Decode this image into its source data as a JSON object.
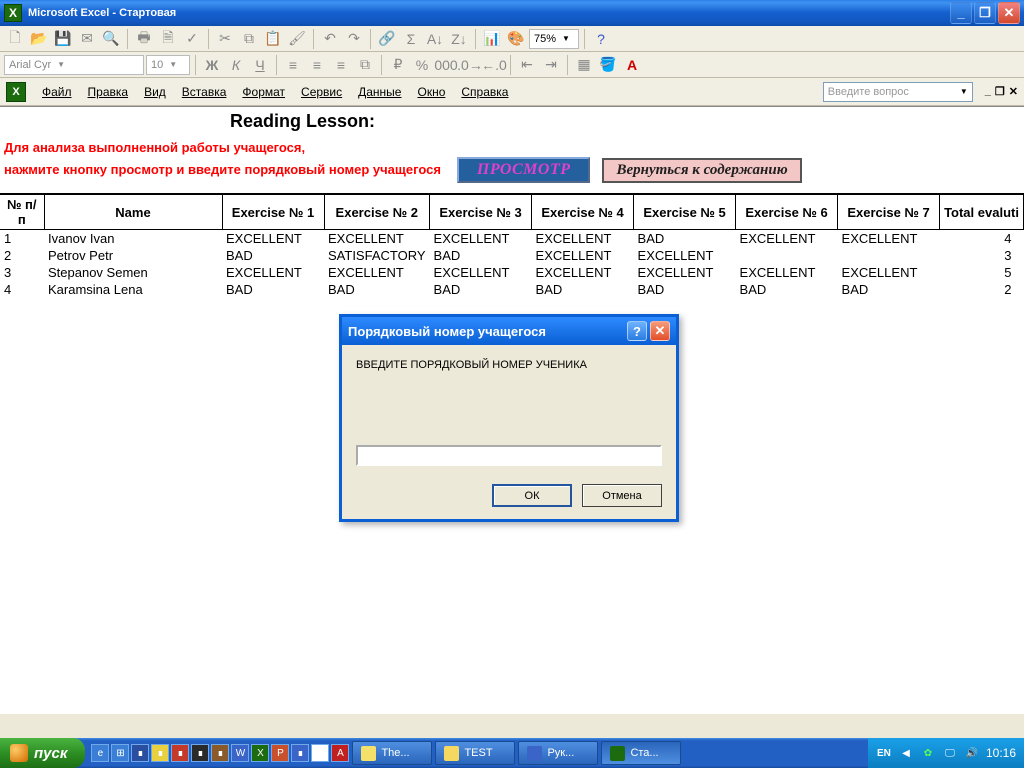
{
  "window": {
    "title": "Microsoft Excel - Стартовая"
  },
  "toolbar": {
    "font": "Arial Cyr",
    "size": "10",
    "zoom": "75%"
  },
  "menu": {
    "file": "Файл",
    "edit": "Правка",
    "view": "Вид",
    "insert": "Вставка",
    "format": "Формат",
    "tools": "Сервис",
    "data": "Данные",
    "window": "Окно",
    "help": "Справка"
  },
  "questionbox_placeholder": "Введите вопрос",
  "sheet": {
    "title": "Reading Lesson:",
    "instr1": "Для анализа  выполненной работы учащегося,",
    "instr2": "нажмите кнопку просмотр и введите порядковый номер учащегося",
    "btn_view": "ПРОСМОТР",
    "btn_return": "Вернуться к содержанию",
    "headers": [
      "№ п/п",
      "Name",
      "Exercise № 1",
      "Exercise № 2",
      "Exercise № 3",
      "Exercise № 4",
      "Exercise № 5",
      "Exercise № 6",
      "Exercise № 7",
      "Total evaluti"
    ],
    "rows": [
      {
        "n": "1",
        "name": "Ivanov Ivan",
        "e": [
          "EXCELLENT",
          "EXCELLENT",
          "EXCELLENT",
          "EXCELLENT",
          "BAD",
          "EXCELLENT",
          "EXCELLENT"
        ],
        "total": "4"
      },
      {
        "n": "2",
        "name": "Petrov Petr",
        "e": [
          "BAD",
          "SATISFACTORY",
          "BAD",
          "EXCELLENT",
          "EXCELLENT",
          "",
          ""
        ],
        "total": "3"
      },
      {
        "n": "3",
        "name": "Stepanov Semen",
        "e": [
          "EXCELLENT",
          "EXCELLENT",
          "EXCELLENT",
          "EXCELLENT",
          "EXCELLENT",
          "EXCELLENT",
          "EXCELLENT"
        ],
        "total": "5"
      },
      {
        "n": "4",
        "name": "Karamsina Lena",
        "e": [
          "BAD",
          "BAD",
          "BAD",
          "BAD",
          "BAD",
          "BAD",
          "BAD"
        ],
        "total": "2"
      }
    ]
  },
  "dialog": {
    "title": "Порядковый номер учащегося",
    "label": "ВВЕДИТЕ ПОРЯДКОВЫЙ НОМЕР УЧЕНИКА",
    "ok": "ОК",
    "cancel": "Отмена",
    "value": ""
  },
  "taskbar": {
    "start": "пуск",
    "tasks": [
      {
        "label": "The...",
        "icon_bg": "#f5e16a"
      },
      {
        "label": "TEST",
        "icon_bg": "#f5d860"
      },
      {
        "label": "Рук...",
        "icon_bg": "#3a64c8"
      },
      {
        "label": "Ста...",
        "icon_bg": "#1d6b0f"
      }
    ],
    "lang": "EN",
    "clock": "10:16"
  }
}
